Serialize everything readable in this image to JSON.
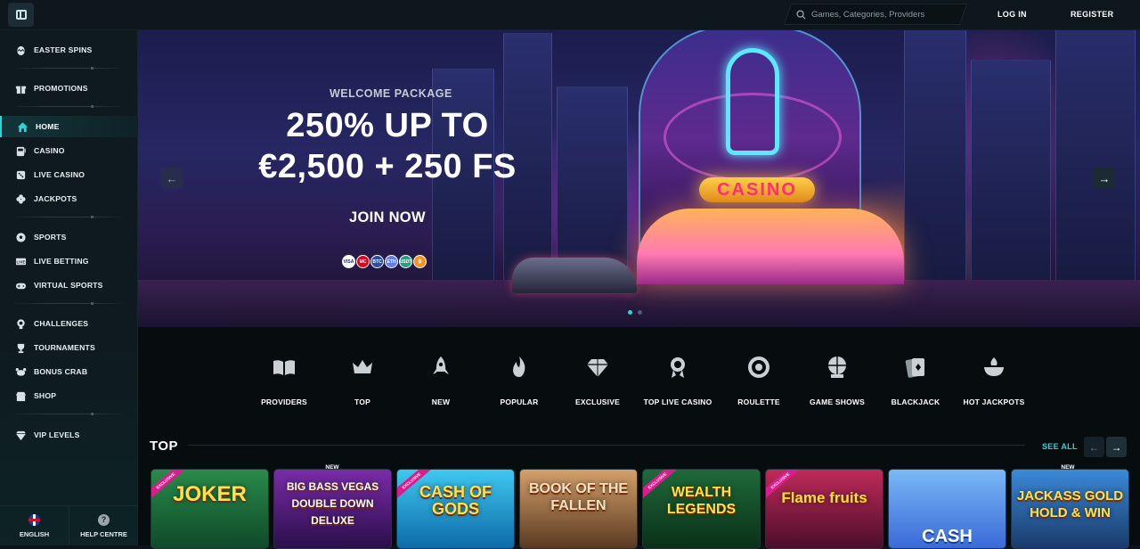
{
  "header": {
    "search_placeholder": "Games, Categories, Providers",
    "login_label": "LOG IN",
    "register_label": "REGISTER"
  },
  "sidebar": {
    "items": [
      {
        "label": "EASTER SPINS",
        "icon": "easter-egg-icon"
      },
      {
        "label": "PROMOTIONS",
        "icon": "gift-icon"
      },
      {
        "label": "HOME",
        "icon": "home-icon",
        "active": true
      },
      {
        "label": "CASINO",
        "icon": "slot-machine-icon"
      },
      {
        "label": "LIVE CASINO",
        "icon": "dice-icon"
      },
      {
        "label": "JACKPOTS",
        "icon": "clover-icon"
      },
      {
        "label": "SPORTS",
        "icon": "soccer-ball-icon"
      },
      {
        "label": "LIVE BETTING",
        "icon": "live-tv-icon"
      },
      {
        "label": "VIRTUAL SPORTS",
        "icon": "gamepad-icon"
      },
      {
        "label": "CHALLENGES",
        "icon": "medal-icon"
      },
      {
        "label": "TOURNAMENTS",
        "icon": "trophy-icon"
      },
      {
        "label": "BONUS CRAB",
        "icon": "crab-icon"
      },
      {
        "label": "SHOP",
        "icon": "shop-icon"
      },
      {
        "label": "VIP LEVELS",
        "icon": "diamond-icon"
      }
    ],
    "footer": {
      "language_label": "ENGLISH",
      "help_label": "HELP CENTRE"
    }
  },
  "hero": {
    "eyebrow": "WELCOME PACKAGE",
    "line1": "250% UP TO",
    "line2": "€2,500 + 250 FS",
    "cta": "JOIN NOW",
    "sign_text": "CASINO",
    "payment_icons": [
      "VISA",
      "MC",
      "BTC",
      "ETH",
      "USDT",
      "₿"
    ],
    "prev_icon": "arrow-left-icon",
    "next_icon": "arrow-right-icon"
  },
  "categories": [
    {
      "label": "PROVIDERS",
      "icon": "book-icon"
    },
    {
      "label": "TOP",
      "icon": "crown-icon"
    },
    {
      "label": "NEW",
      "icon": "rocket-icon"
    },
    {
      "label": "POPULAR",
      "icon": "flame-icon"
    },
    {
      "label": "EXCLUSIVE",
      "icon": "diamond-icon"
    },
    {
      "label": "TOP LIVE CASINO",
      "icon": "rosette-icon"
    },
    {
      "label": "ROULETTE",
      "icon": "roulette-icon"
    },
    {
      "label": "GAME SHOWS",
      "icon": "wheel-icon"
    },
    {
      "label": "BLACKJACK",
      "icon": "cards-icon"
    },
    {
      "label": "HOT JACKPOTS",
      "icon": "hot-pot-icon"
    }
  ],
  "top_section": {
    "title": "TOP",
    "see_all": "SEE ALL",
    "games": [
      {
        "title": "JOKER",
        "badge": "EXCLUSIVE",
        "new": ""
      },
      {
        "title": "BIG BASS VEGAS DOUBLE DOWN DELUXE",
        "badge": "",
        "new": "NEW"
      },
      {
        "title": "CASH OF GODS",
        "badge": "EXCLUSIVE",
        "new": ""
      },
      {
        "title": "BOOK OF THE FALLEN",
        "badge": "",
        "new": ""
      },
      {
        "title": "WEALTH LEGENDS",
        "badge": "EXCLUSIVE",
        "new": ""
      },
      {
        "title": "Flame fruits",
        "badge": "EXCLUSIVE",
        "new": ""
      },
      {
        "title": "CASH",
        "badge": "",
        "new": ""
      },
      {
        "title": "JACKASS GOLD HOLD & WIN",
        "badge": "",
        "new": "NEW"
      }
    ]
  }
}
